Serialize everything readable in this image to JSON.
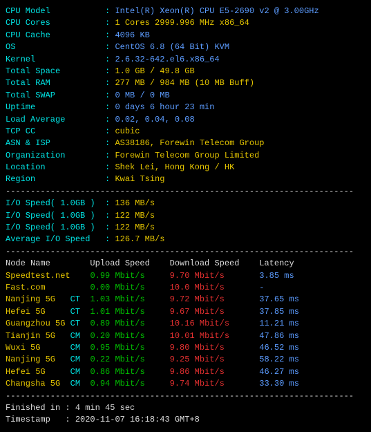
{
  "sys": [
    {
      "label": "CPU Model",
      "value": "Intel(R) Xeon(R) CPU E5-2690 v2 @ 3.00GHz",
      "vc": "blue"
    },
    {
      "label": "CPU Cores",
      "value": "1 Cores 2999.996 MHz x86_64",
      "vc": "yellow",
      "num": "1"
    },
    {
      "label": "CPU Cache",
      "value": "4096 KB",
      "vc": "blue"
    },
    {
      "label": "OS",
      "value": "CentOS 6.8 (64 Bit) KVM",
      "vc": "blue"
    },
    {
      "label": "Kernel",
      "value": "2.6.32-642.el6.x86_64",
      "vc": "blue"
    },
    {
      "label": "Total Space",
      "value": "1.0 GB / 49.8 GB",
      "vc": "yellow"
    },
    {
      "label": "Total RAM",
      "value": "277 MB / 984 MB (10 MB Buff)",
      "vc": "yellow"
    },
    {
      "label": "Total SWAP",
      "value": "0 MB / 0 MB",
      "vc": "blue"
    },
    {
      "label": "Uptime",
      "value": "0 days 6 hour 23 min",
      "vc": "blue"
    },
    {
      "label": "Load Average",
      "value": "0.02, 0.04, 0.08",
      "vc": "blue"
    },
    {
      "label": "TCP CC",
      "value": "cubic",
      "vc": "yellow"
    },
    {
      "label": "ASN & ISP",
      "value": "AS38186, Forewin Telecom Group",
      "vc": "yellow"
    },
    {
      "label": "Organization",
      "value": "Forewin Telecom Group Limited",
      "vc": "yellow"
    },
    {
      "label": "Location",
      "value": "Shek Lei, Hong Kong / HK",
      "vc": "yellow"
    },
    {
      "label": "Region",
      "value": "Kwai Tsing",
      "vc": "yellow"
    }
  ],
  "io": [
    {
      "label": "I/O Speed( 1.0GB )",
      "value": "136 MB/s",
      "vc": "yellow"
    },
    {
      "label": "I/O Speed( 1.0GB )",
      "value": "122 MB/s",
      "vc": "yellow"
    },
    {
      "label": "I/O Speed( 1.0GB )",
      "value": "122 MB/s",
      "vc": "yellow"
    },
    {
      "label": "Average I/O Speed",
      "value": "126.7 MB/s",
      "vc": "yellow"
    }
  ],
  "speed_header": {
    "c1": "Node Name",
    "c2": "Upload Speed",
    "c3": "Download Speed",
    "c4": "Latency"
  },
  "speed": [
    {
      "name": "Speedtest.net",
      "tag": "",
      "up": "0.99 Mbit/s",
      "down": "9.70 Mbit/s",
      "lat": "3.85 ms"
    },
    {
      "name": "Fast.com",
      "tag": "",
      "up": "0.00 Mbit/s",
      "down": "10.0 Mbit/s",
      "lat": "-"
    },
    {
      "name": "Nanjing 5G",
      "tag": "CT",
      "up": "1.03 Mbit/s",
      "down": "9.72 Mbit/s",
      "lat": "37.65 ms"
    },
    {
      "name": "Hefei 5G",
      "tag": "CT",
      "up": "1.01 Mbit/s",
      "down": "9.67 Mbit/s",
      "lat": "37.85 ms"
    },
    {
      "name": "Guangzhou 5G",
      "tag": "CT",
      "up": "0.89 Mbit/s",
      "down": "10.16 Mbit/s",
      "lat": "11.21 ms"
    },
    {
      "name": "Tianjin 5G",
      "tag": "CM",
      "up": "0.20 Mbit/s",
      "down": "10.01 Mbit/s",
      "lat": "47.86 ms"
    },
    {
      "name": "Wuxi 5G",
      "tag": "CM",
      "up": "0.95 Mbit/s",
      "down": "9.80 Mbit/s",
      "lat": "46.52 ms"
    },
    {
      "name": "Nanjing 5G",
      "tag": "CM",
      "up": "0.22 Mbit/s",
      "down": "9.25 Mbit/s",
      "lat": "58.22 ms"
    },
    {
      "name": "Hefei 5G",
      "tag": "CM",
      "up": "0.86 Mbit/s",
      "down": "9.86 Mbit/s",
      "lat": "46.27 ms"
    },
    {
      "name": "Changsha 5G",
      "tag": "CM",
      "up": "0.94 Mbit/s",
      "down": "9.74 Mbit/s",
      "lat": "33.30 ms"
    }
  ],
  "footer": [
    {
      "label": "Finished in",
      "value": "4 min 45 sec"
    },
    {
      "label": "Timestamp",
      "value": "2020-11-07 16:18:43 GMT+8"
    }
  ],
  "divider": "----------------------------------------------------------------------"
}
